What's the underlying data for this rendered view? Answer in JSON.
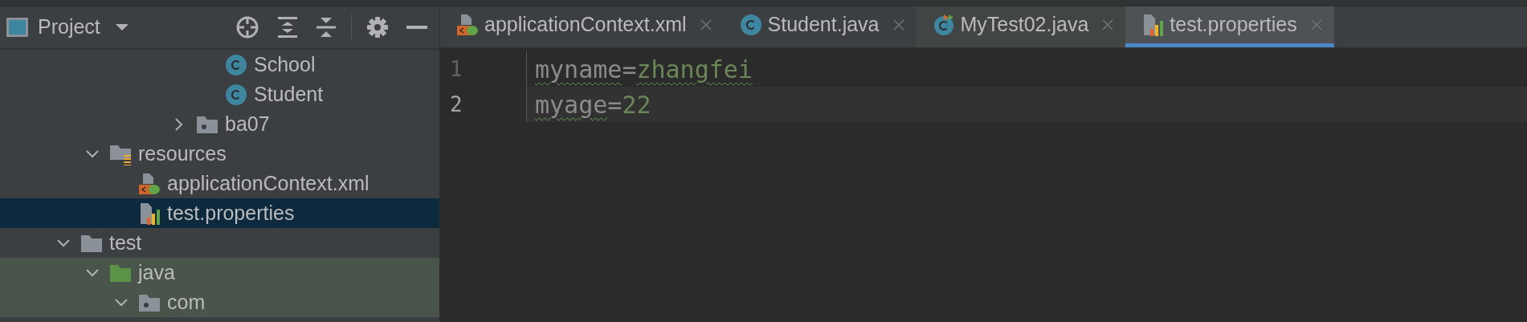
{
  "project_panel": {
    "title": "Project"
  },
  "tree": [
    {
      "children": [
        {
          "children": [
            {
              "children": [
                {
                  "children": [
                    {
                      "children": [
                        {
                          "label": "School",
                          "kind": "class"
                        },
                        {
                          "label": "Student",
                          "kind": "class"
                        }
                      ]
                    },
                    {
                      "label": "ba07",
                      "kind": "package",
                      "expanded": false
                    }
                  ]
                }
              ]
            }
          ]
        },
        {
          "label": "resources",
          "kind": "resources_root",
          "expanded": true,
          "children": [
            {
              "label": "applicationContext.xml",
              "kind": "xml",
              "selected": false
            },
            {
              "label": "test.properties",
              "kind": "properties",
              "selected": true
            }
          ]
        }
      ]
    },
    {
      "label": "test",
      "kind": "folder",
      "expanded": true,
      "children": [
        {
          "label": "java",
          "kind": "test_root",
          "test_source": true,
          "expanded": true,
          "children": [
            {
              "label": "com",
              "kind": "package",
              "expanded": true
            }
          ]
        }
      ]
    }
  ],
  "tabs": [
    {
      "label": "applicationContext.xml",
      "kind": "xml",
      "selected": false
    },
    {
      "label": "Student.java",
      "kind": "class",
      "selected": false
    },
    {
      "label": "MyTest02.java",
      "kind": "test_class",
      "selected": false
    },
    {
      "label": "test.properties",
      "kind": "properties",
      "selected": true
    }
  ],
  "editor": {
    "lines": [
      {
        "number": "1",
        "current": false,
        "tokens": [
          {
            "text": "myname",
            "kind": "key",
            "typo": true
          },
          {
            "text": "=",
            "kind": "sep",
            "typo": false
          },
          {
            "text": "zhangfei",
            "kind": "value",
            "typo": true
          }
        ]
      },
      {
        "number": "2",
        "current": true,
        "tokens": [
          {
            "text": "myage",
            "kind": "key",
            "typo": true
          },
          {
            "text": "=",
            "kind": "sep",
            "typo": false
          },
          {
            "text": "22",
            "kind": "value",
            "typo": false
          }
        ]
      }
    ]
  }
}
